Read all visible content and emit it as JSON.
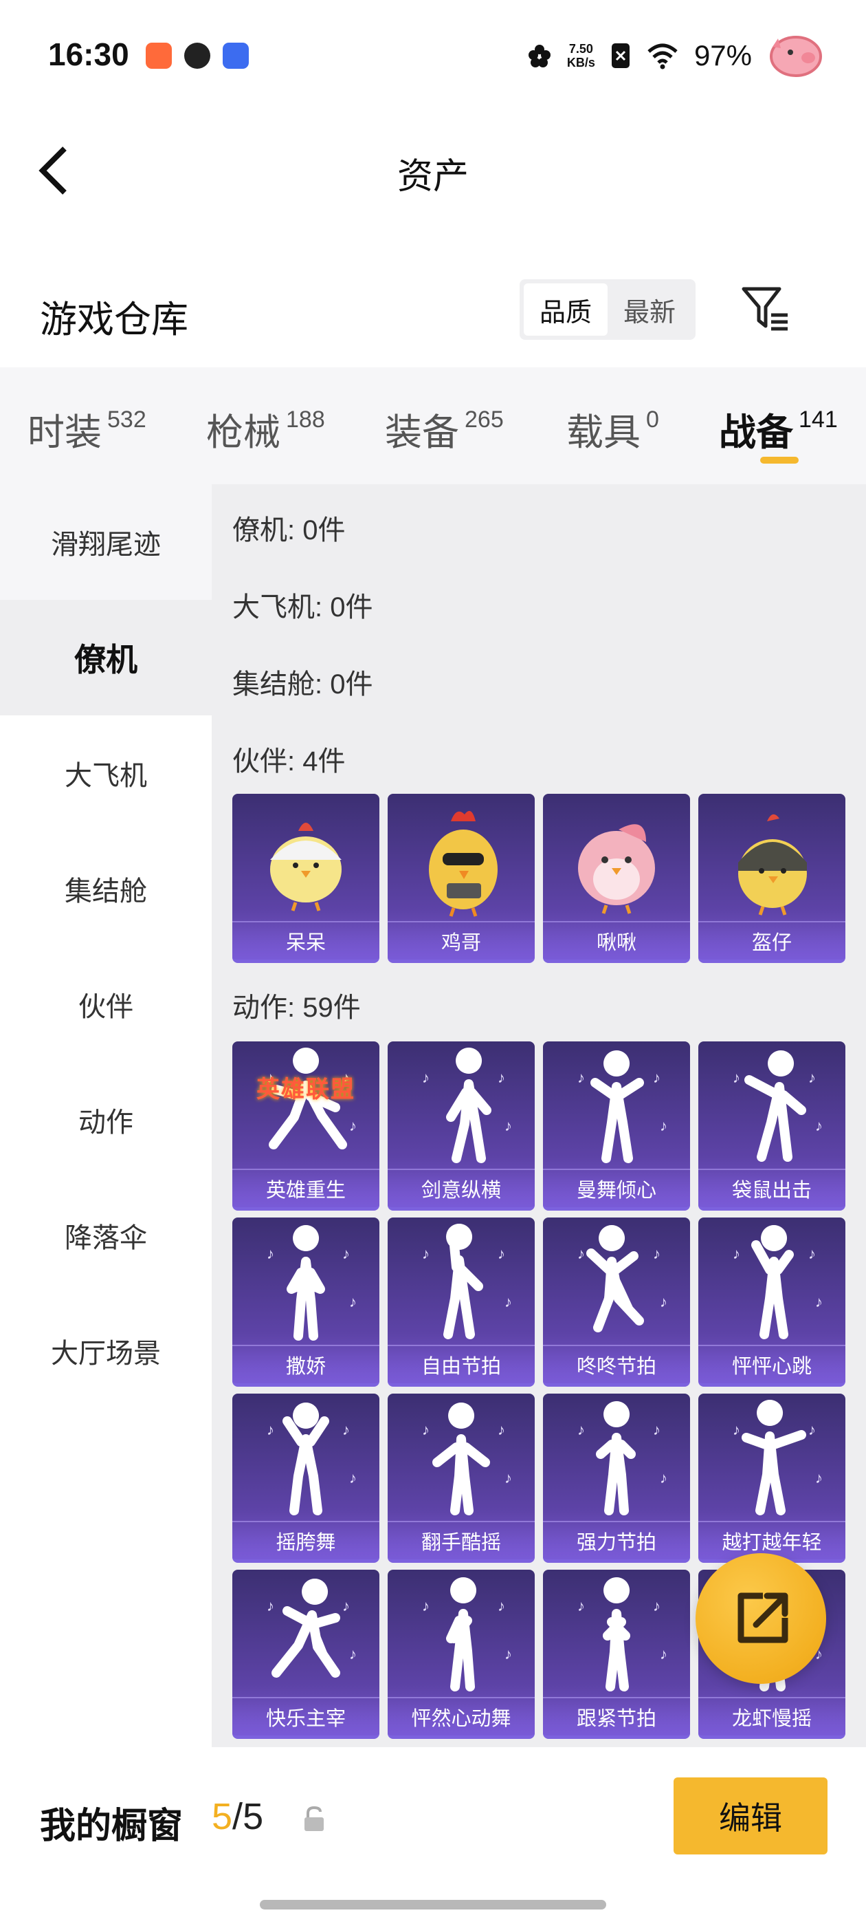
{
  "status_bar": {
    "time": "16:30",
    "net_speed_value": "7.50",
    "net_speed_unit": "KB/s",
    "battery": "97%",
    "icons": [
      "kuaishou-app-icon",
      "browser-app-icon",
      "assistant-app-icon",
      "flower-icon",
      "sim-off-icon",
      "wifi-icon",
      "pig-mascot-icon"
    ]
  },
  "header": {
    "title": "资产"
  },
  "repo": {
    "title": "游戏仓库",
    "sort_options": [
      "品质",
      "最新"
    ],
    "active_sort": "品质"
  },
  "tabs": [
    {
      "label": "时装",
      "count": "532"
    },
    {
      "label": "枪械",
      "count": "188"
    },
    {
      "label": "装备",
      "count": "265"
    },
    {
      "label": "载具",
      "count": "0"
    },
    {
      "label": "战备",
      "count": "141"
    }
  ],
  "active_tab": "战备",
  "sidebar": [
    {
      "label": "滑翔尾迹"
    },
    {
      "label": "僚机"
    },
    {
      "label": "大飞机"
    },
    {
      "label": "集结舱"
    },
    {
      "label": "伙伴"
    },
    {
      "label": "动作"
    },
    {
      "label": "降落伞"
    },
    {
      "label": "大厅场景"
    }
  ],
  "active_sidebar": "僚机",
  "sections": {
    "wingman": "僚机: 0件",
    "plane": "大飞机: 0件",
    "pod": "集结舱: 0件",
    "partner": "伙伴: 4件",
    "action": "动作: 59件"
  },
  "partners": [
    {
      "name": "呆呆"
    },
    {
      "name": "鸡哥"
    },
    {
      "name": "啾啾"
    },
    {
      "name": "盔仔"
    }
  ],
  "actions": [
    {
      "name": "英雄重生",
      "banner": "英雄联盟"
    },
    {
      "name": "剑意纵横"
    },
    {
      "name": "曼舞倾心"
    },
    {
      "name": "袋鼠出击"
    },
    {
      "name": "撒娇"
    },
    {
      "name": "自由节拍"
    },
    {
      "name": "咚咚节拍"
    },
    {
      "name": "怦怦心跳"
    },
    {
      "name": "摇胯舞"
    },
    {
      "name": "翻手酷摇"
    },
    {
      "name": "强力节拍"
    },
    {
      "name": "越打越年轻"
    },
    {
      "name": "快乐主宰"
    },
    {
      "name": "怦然心动舞"
    },
    {
      "name": "跟紧节拍"
    },
    {
      "name": "龙虾慢摇"
    }
  ],
  "showcase": {
    "label": "我的橱窗",
    "current": "5",
    "separator": "/",
    "total": "5",
    "edit_label": "编辑"
  },
  "colors": {
    "accent": "#f5b82e",
    "card_top": "#3c2f72",
    "card_bottom": "#7a5ad0"
  }
}
